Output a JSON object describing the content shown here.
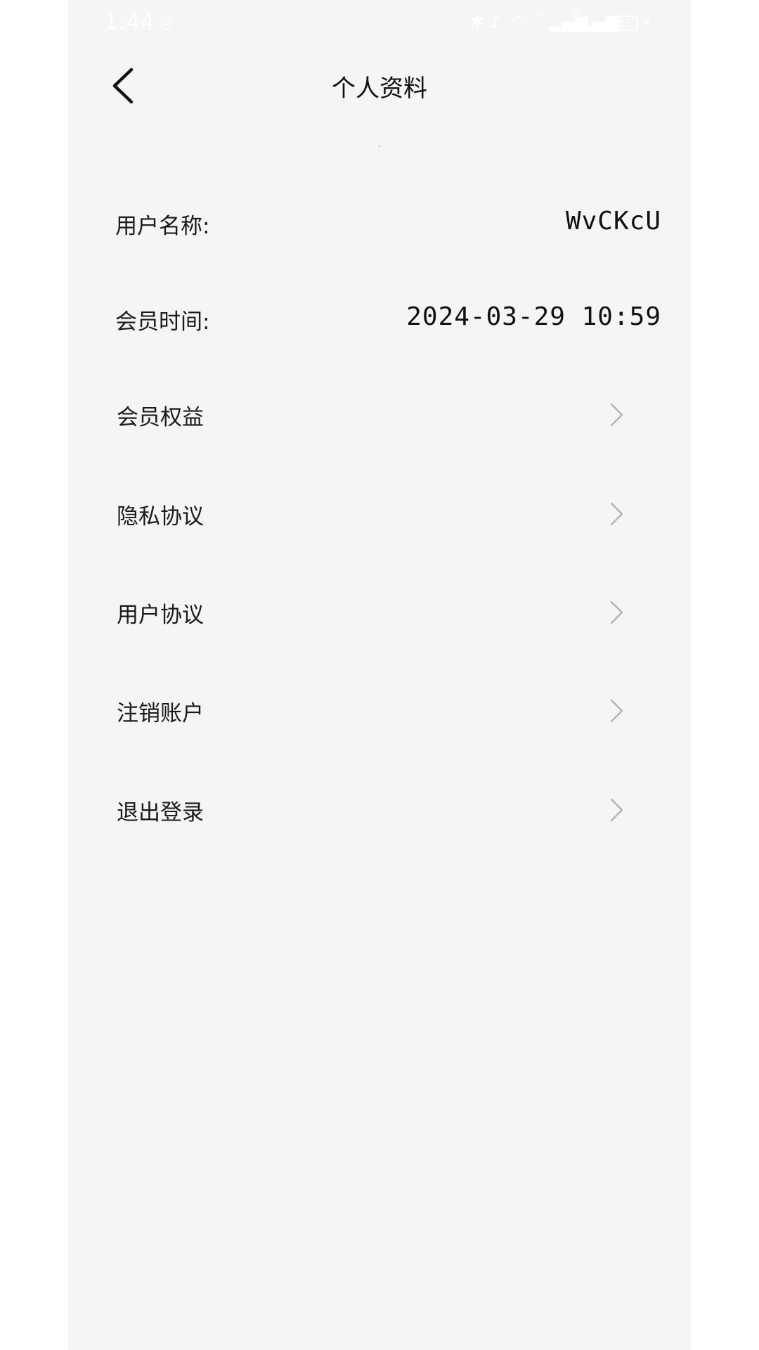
{
  "status_bar": {
    "time": "1:44",
    "network_left": "⁴ᴳ",
    "network_right": "ᴴᴰ",
    "battery": "33"
  },
  "header": {
    "title": "个人资料"
  },
  "profile": {
    "username_label": "用户名称:",
    "username_value": "WvCKcU",
    "membership_label": "会员时间:",
    "membership_value": "2024-03-29 10:59"
  },
  "menu": {
    "items": [
      {
        "label": "会员权益"
      },
      {
        "label": "隐私协议"
      },
      {
        "label": "用户协议"
      },
      {
        "label": "注销账户"
      },
      {
        "label": "退出登录"
      }
    ]
  },
  "icons": {
    "back": "back-arrow-icon",
    "chevron": "chevron-right-icon"
  },
  "colors": {
    "background": "#f5f5f5",
    "text": "#1a1a1a",
    "chevron": "#b4b4b4"
  }
}
